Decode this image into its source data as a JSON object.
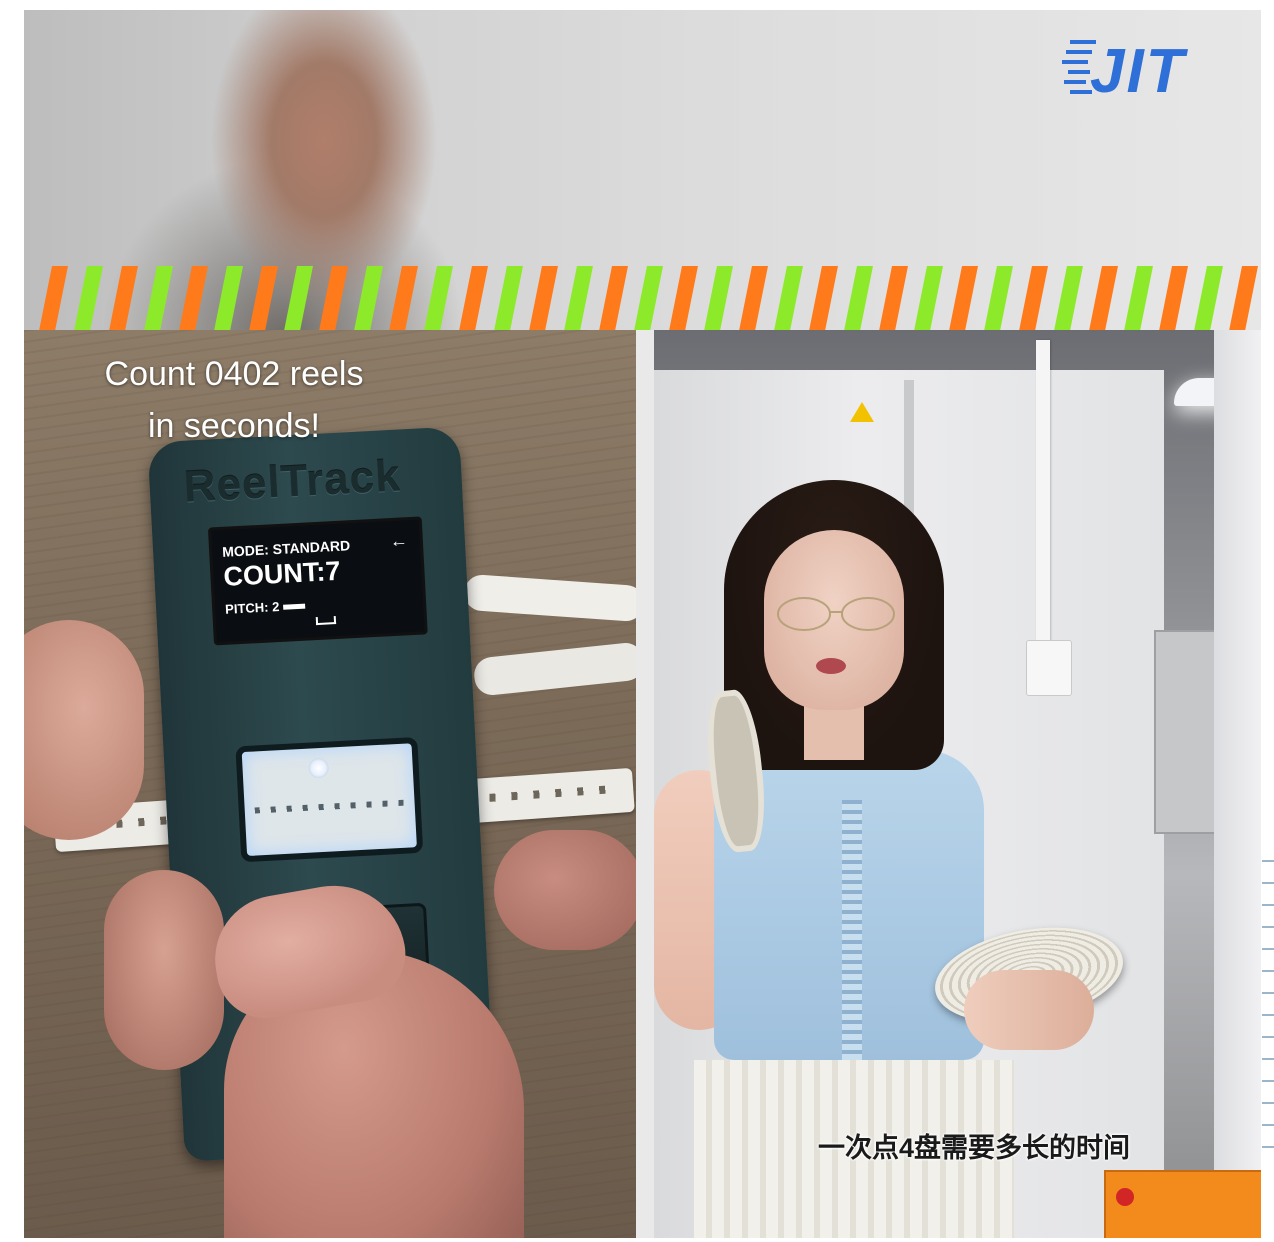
{
  "overlay": {
    "caption_en_line1": "Count 0402 reels",
    "caption_en_line2": "in seconds!",
    "caption_cn": "一次点4盘需要多长的时间"
  },
  "logo": {
    "text": "JIT",
    "color": "#2f6fd8"
  },
  "device": {
    "brand": "ReelTrack",
    "screen": {
      "mode": "MODE: STANDARD",
      "count": "COUNT:7",
      "pitch": "PITCH: 2"
    }
  },
  "stripe_colors": [
    "#ff7a1a",
    "#8dea2a"
  ]
}
